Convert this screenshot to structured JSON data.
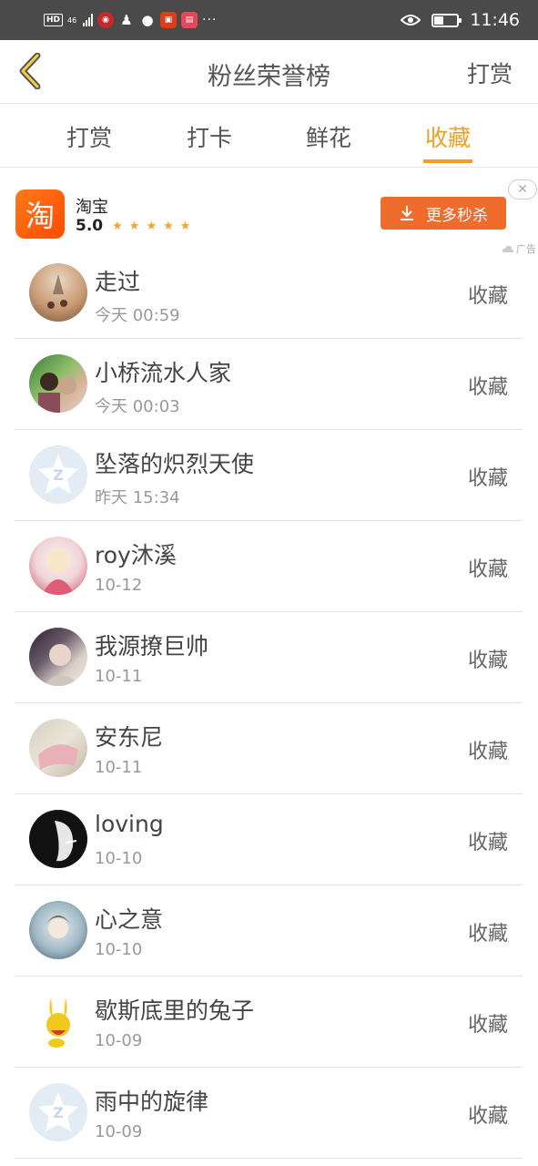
{
  "status_bar": {
    "badge": "HD",
    "network": "46",
    "time": "11:46",
    "dots": "···"
  },
  "header": {
    "title": "粉丝荣誉榜",
    "right_button": "打赏"
  },
  "tabs": [
    {
      "label": "打赏",
      "active": false
    },
    {
      "label": "打卡",
      "active": false
    },
    {
      "label": "鲜花",
      "active": false
    },
    {
      "label": "收藏",
      "active": true
    }
  ],
  "ad": {
    "app_name": "淘宝",
    "logo_char": "淘",
    "score": "5.0",
    "stars": 5,
    "cta": "更多秒杀",
    "close": "✕",
    "tag": "广告"
  },
  "fans": [
    {
      "name": "走过",
      "time": "今天 00:59",
      "action": "收藏"
    },
    {
      "name": "小桥流水人家",
      "time": "今天 00:03",
      "action": "收藏"
    },
    {
      "name": "坠落的炽烈天使",
      "time": "昨天 15:34",
      "action": "收藏"
    },
    {
      "name": "roy沐溪",
      "time": "10-12",
      "action": "收藏"
    },
    {
      "name": "我源撩巨帅",
      "time": "10-11",
      "action": "收藏"
    },
    {
      "name": "安东尼",
      "time": "10-11",
      "action": "收藏"
    },
    {
      "name": "loving",
      "time": "10-10",
      "action": "收藏"
    },
    {
      "name": "心之意",
      "time": "10-10",
      "action": "收藏"
    },
    {
      "name": "歇斯底里的兔子",
      "time": "10-09",
      "action": "收藏"
    },
    {
      "name": "雨中的旋律",
      "time": "10-09",
      "action": "收藏"
    }
  ],
  "colors": {
    "accent": "#f0a020",
    "cta": "#ef6c2d",
    "status_bar": "#4a4a4a"
  }
}
